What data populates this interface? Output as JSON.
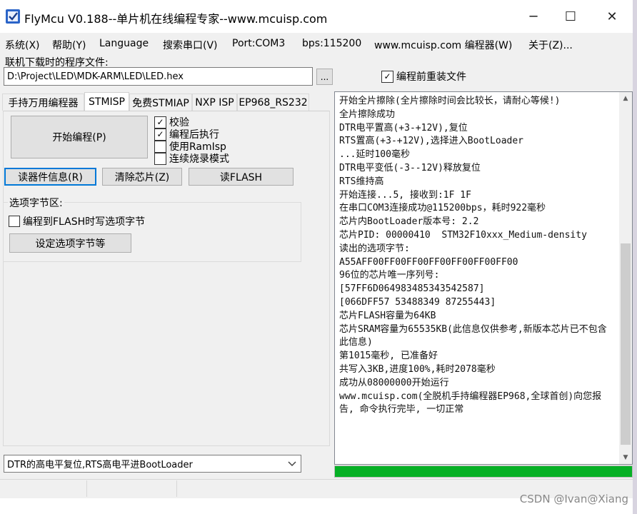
{
  "window": {
    "title": "FlyMcu V0.188--单片机在线编程专家--www.mcuisp.com",
    "minimize_glyph": "─",
    "maximize_glyph": "☐",
    "close_glyph": "✕"
  },
  "menu": {
    "items": [
      "系统(X)",
      "帮助(Y)",
      "Language",
      "搜索串口(V)",
      "Port:COM3",
      "bps:115200",
      "www.mcuisp.com 编程器(W)",
      "关于(Z)..."
    ]
  },
  "file": {
    "label": "联机下载时的程序文件:",
    "path": "D:\\Project\\LED\\MDK-ARM\\LED\\LED.hex",
    "browse_label": "...",
    "reload_label": "编程前重装文件",
    "reload_checked": "✓"
  },
  "tabs": [
    "手持万用编程器",
    "STMISP",
    "免费STMIAP",
    "NXP ISP",
    "EP968_RS232"
  ],
  "stmisp": {
    "start_button": "开始编程(P)",
    "checks": [
      {
        "label": "校验",
        "mark": "✓"
      },
      {
        "label": "编程后执行",
        "mark": "✓"
      },
      {
        "label": "使用RamIsp",
        "mark": ""
      },
      {
        "label": "连续烧录模式",
        "mark": ""
      }
    ],
    "read_info_button": "读器件信息(R)",
    "erase_button": "清除芯片(Z)",
    "read_flash_button": "读FLASH",
    "option_group_title": "选项字节区:",
    "option_flash_label": "编程到FLASH时写选项字节",
    "option_set_button": "设定选项字节等"
  },
  "dtr_select": {
    "value": "DTR的高电平复位,RTS高电平进BootLoader"
  },
  "log": {
    "text": "开始全片擦除(全片擦除时间会比较长，请耐心等候!)\n全片擦除成功\nDTR电平置高(+3-+12V),复位\nRTS置高(+3-+12V),选择进入BootLoader\n...延时100毫秒\nDTR电平变低(-3--12V)释放复位\nRTS维持高\n开始连接...5, 接收到:1F 1F\n在串口COM3连接成功@115200bps，耗时922毫秒\n芯片内BootLoader版本号: 2.2\n芯片PID: 00000410  STM32F10xxx_Medium-density\n读出的选项字节:\nA55AFF00FF00FF00FF00FF00FF00FF00\n96位的芯片唯一序列号:\n[57FF6D064983485343542587]\n[066DFF57 53488349 87255443]\n芯片FLASH容量为64KB\n芯片SRAM容量为65535KB(此信息仅供参考,新版本芯片已不包含此信息)\n第1015毫秒, 已准备好\n共写入3KB,进度100%,耗时2078毫秒\n成功从08000000开始运行\nwww.mcuisp.com(全脱机手持编程器EP968,全球首创)向您报告, 命令执行完毕, 一切正常"
  },
  "progress": {
    "value": 1.0,
    "color": "#06b025"
  },
  "watermark": "CSDN @Ivan@Xiang"
}
